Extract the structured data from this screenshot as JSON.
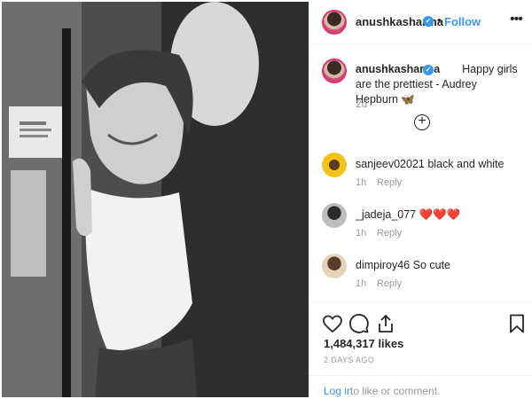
{
  "post": {
    "photo_alt": "",
    "header": {
      "username": "anushkasharma",
      "verified_icon": "verified-badge-icon",
      "separator": "•",
      "follow_label": "Follow",
      "more_icon": "more-options-icon",
      "more_label": "•••"
    },
    "caption": {
      "username": "anushkasharma",
      "text": "Happy girls are the prettiest - Audrey Hepburn 🦋",
      "time": "2d",
      "load_more_icon": "plus-circle-icon",
      "load_more_label": "+"
    },
    "comments": [
      {
        "username": "sanjeev02021",
        "text": "black and white",
        "time": "1h",
        "reply_label": "Reply",
        "avatar_icon": "sunflower-avatar"
      },
      {
        "username": "_jadeja_077",
        "text": "❤️❤️❤️",
        "time": "1h",
        "reply_label": "Reply",
        "avatar_icon": "user-avatar"
      },
      {
        "username": "dimpiroy46",
        "text": "So cute",
        "time": "1h",
        "reply_label": "Reply",
        "avatar_icon": "user-avatar"
      }
    ],
    "actions": {
      "like_icon": "heart-icon",
      "comment_icon": "comment-icon",
      "share_icon": "share-icon",
      "save_icon": "bookmark-icon",
      "likes_text": "1,484,317 likes",
      "posted_text": "2 DAYS AGO"
    },
    "login": {
      "link_text": "Log in",
      "rest_text": "to like or comment."
    }
  },
  "colors": {
    "accent": "#3897f0",
    "text": "#262626",
    "muted": "#999999",
    "border": "#efefef"
  }
}
